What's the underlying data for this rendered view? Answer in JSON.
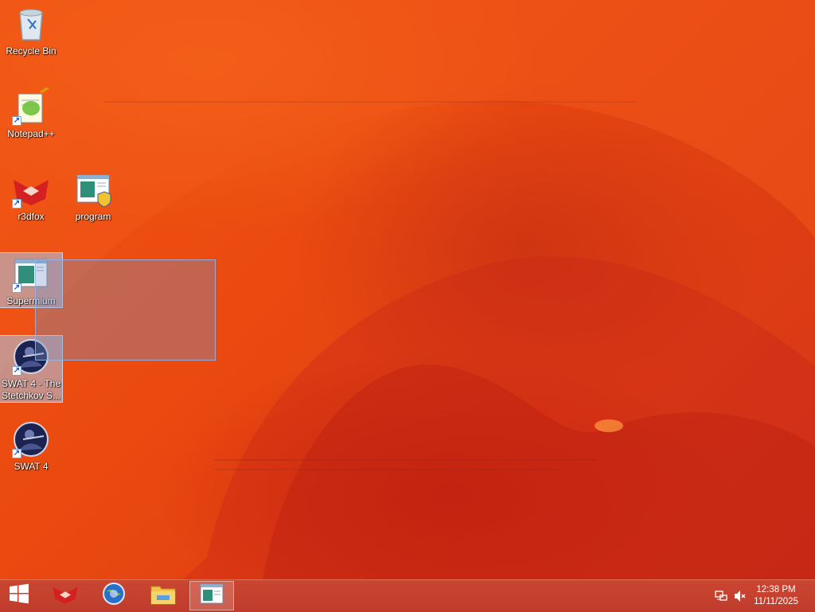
{
  "desktop": {
    "icons": [
      {
        "label": "Recycle Bin",
        "icon": "recycle-bin-icon",
        "shortcut": false,
        "selected": false
      },
      {
        "label": "Notepad++",
        "icon": "notepad-plus-plus-icon",
        "shortcut": true,
        "selected": false
      },
      {
        "label": "r3dfox",
        "icon": "r3dfox-icon",
        "shortcut": true,
        "selected": false
      },
      {
        "label": "program",
        "icon": "program-icon",
        "shortcut": false,
        "selected": false
      },
      {
        "label": "Supermium",
        "icon": "supermium-icon",
        "shortcut": true,
        "selected": true
      },
      {
        "label": "SWAT 4 - The Stetchkov S...",
        "icon": "swat4-expansion-icon",
        "shortcut": true,
        "selected": true
      },
      {
        "label": "SWAT 4",
        "icon": "swat4-icon",
        "shortcut": true,
        "selected": false
      }
    ]
  },
  "taskbar": {
    "start_icon": "windows-start-icon",
    "pinned": [
      {
        "name": "r3dfox",
        "icon": "r3dfox-icon",
        "active": false
      },
      {
        "name": "browser",
        "icon": "browser-globe-icon",
        "active": false
      },
      {
        "name": "File Explorer",
        "icon": "folder-icon",
        "active": false
      },
      {
        "name": "program",
        "icon": "program-window-icon",
        "active": true
      }
    ],
    "tray": {
      "network_icon": "network-icon",
      "volume_icon": "volume-muted-icon",
      "time": "12:38 PM",
      "date": "11/11/2025"
    }
  },
  "colors": {
    "wallpaper": "#e8450f",
    "taskbar": "#c4462f",
    "selection": "#aac8eb"
  }
}
